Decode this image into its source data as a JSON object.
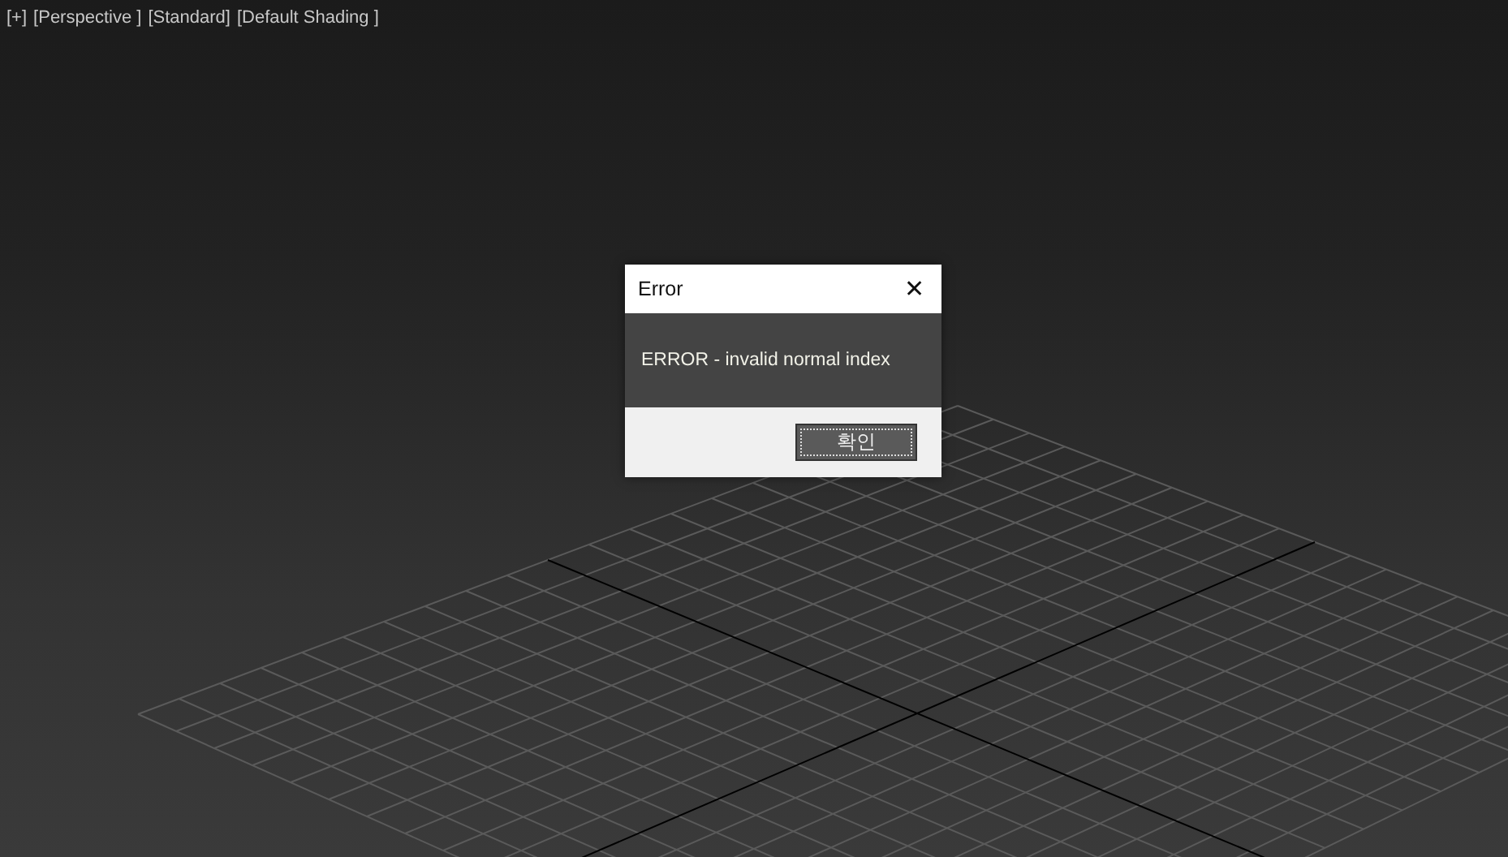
{
  "viewport_labels": [
    "[+]",
    "[Perspective ]",
    "[Standard]",
    "[Default Shading ]"
  ],
  "dialog": {
    "title": "Error",
    "close": "✕",
    "message": "ERROR - invalid normal index",
    "buttons": [
      {
        "label": "확인",
        "focused": true
      }
    ]
  }
}
